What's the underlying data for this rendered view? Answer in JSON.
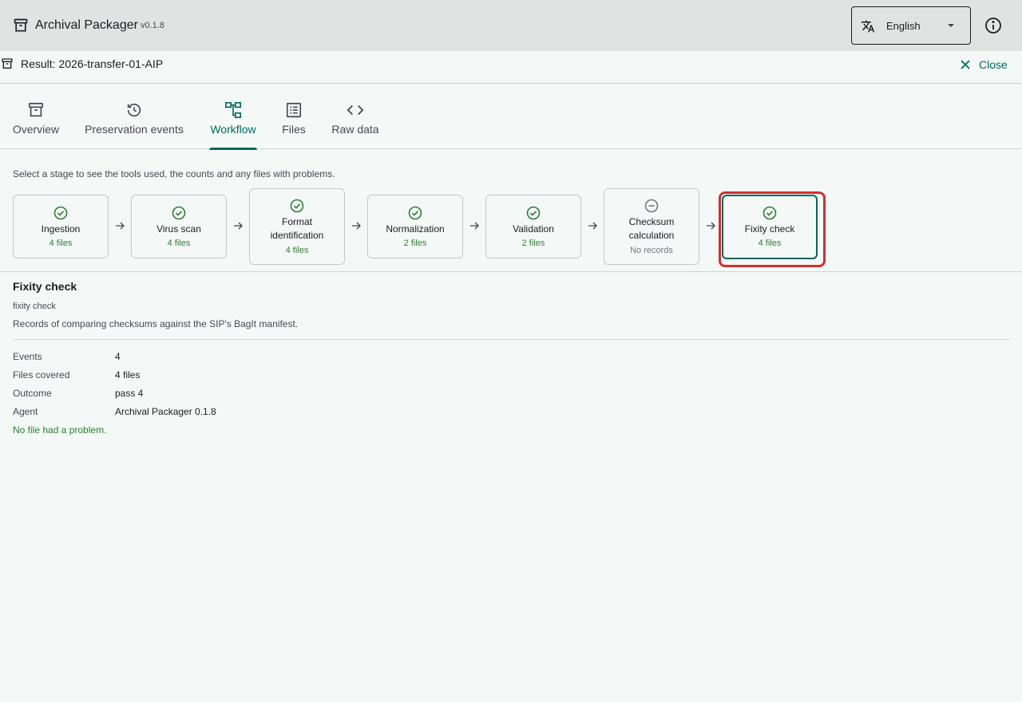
{
  "app": {
    "title": "Archival Packager",
    "version": "v0.1.8"
  },
  "language": {
    "label": "English"
  },
  "result": {
    "title": "Result: 2026-transfer-01-AIP",
    "close_label": "Close"
  },
  "tabs": [
    {
      "label": "Overview",
      "icon": "archive-icon"
    },
    {
      "label": "Preservation events",
      "icon": "history-icon"
    },
    {
      "label": "Workflow",
      "icon": "workflow-icon",
      "active": true
    },
    {
      "label": "Files",
      "icon": "list-icon"
    },
    {
      "label": "Raw data",
      "icon": "code-icon"
    }
  ],
  "workflow": {
    "hint": "Select a stage to see the tools used, the counts and any files with problems.",
    "stages": [
      {
        "name": "Ingestion",
        "count": "4 files",
        "status": "success"
      },
      {
        "name": "Virus scan",
        "count": "4 files",
        "status": "success"
      },
      {
        "name_line1": "Format",
        "name_line2": "identification",
        "count": "4 files",
        "status": "success"
      },
      {
        "name": "Normalization",
        "count": "2 files",
        "status": "success"
      },
      {
        "name": "Validation",
        "count": "2 files",
        "status": "success"
      },
      {
        "name_line1": "Checksum",
        "name_line2": "calculation",
        "count": "No records",
        "status": "none"
      },
      {
        "name": "Fixity check",
        "count": "4 files",
        "status": "success",
        "selected": true
      }
    ]
  },
  "detail": {
    "title": "Fixity check",
    "subtitle": "fixity check",
    "description": "Records of comparing checksums against the SIP's BagIt manifest.",
    "rows": [
      {
        "key": "Events",
        "value": "4"
      },
      {
        "key": "Files covered",
        "value": "4 files"
      },
      {
        "key": "Outcome",
        "value": "pass 4"
      },
      {
        "key": "Agent",
        "value": "Archival Packager 0.1.8"
      }
    ],
    "ok_note": "No file had a problem."
  },
  "colors": {
    "accent": "#00695c",
    "success": "#2e7d32",
    "highlight": "#d32f2f",
    "appbar": "#dfe4e3"
  }
}
